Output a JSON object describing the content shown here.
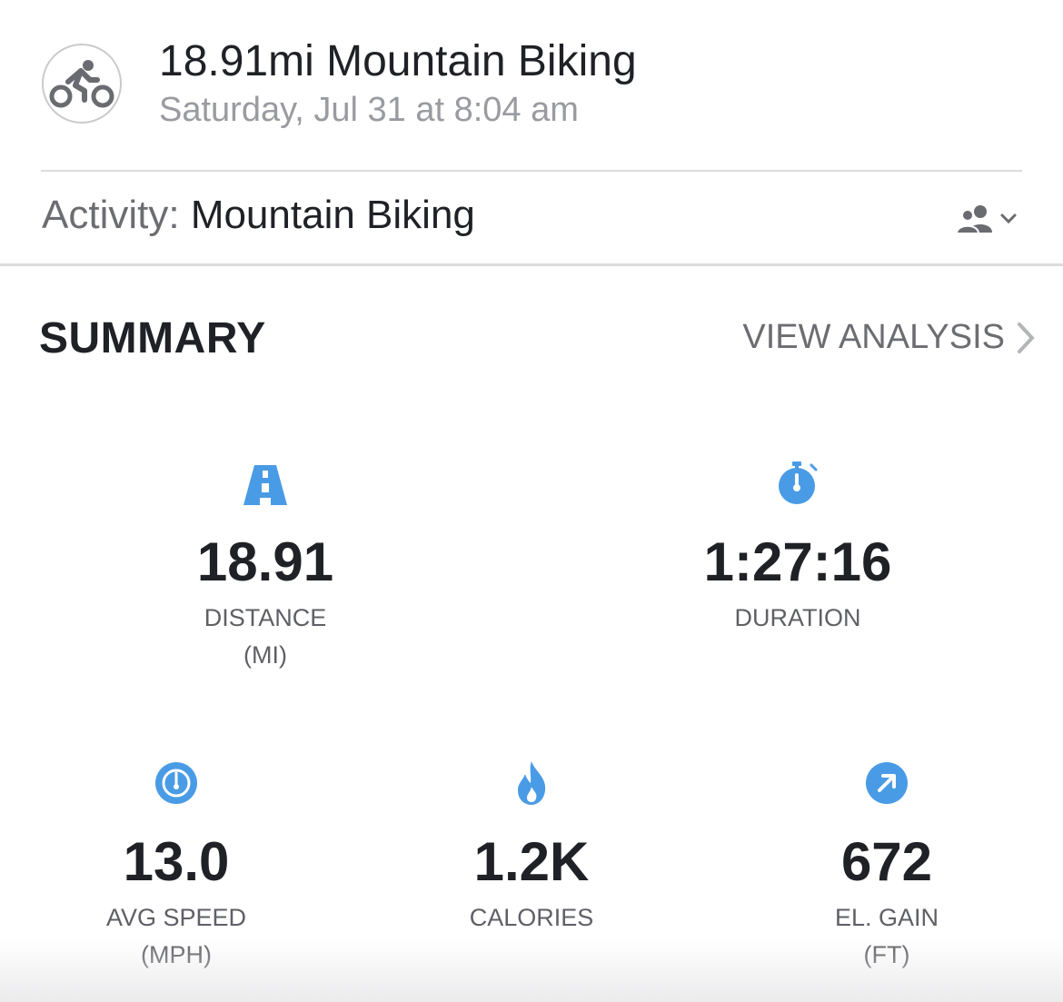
{
  "header": {
    "sport_icon": "bicycle-icon",
    "title": "18.91mi Mountain Biking",
    "subtitle": "Saturday, Jul 31 at 8:04 am"
  },
  "activity": {
    "label": "Activity:",
    "value": "Mountain Biking",
    "privacy_icon": "friends-icon"
  },
  "summary": {
    "title": "SUMMARY",
    "view_analysis": "VIEW ANALYSIS"
  },
  "stats": {
    "distance": {
      "icon": "road-icon",
      "value": "18.91",
      "label": "DISTANCE",
      "unit": "(MI)"
    },
    "duration": {
      "icon": "stopwatch-icon",
      "value": "1:27:16",
      "label": "DURATION"
    },
    "avg_speed": {
      "icon": "speedometer-icon",
      "value": "13.0",
      "label": "AVG SPEED",
      "unit": "(MPH)"
    },
    "calories": {
      "icon": "flame-icon",
      "value": "1.2K",
      "label": "CALORIES"
    },
    "elevation": {
      "icon": "arrow-up-right-icon",
      "value": "672",
      "label": "EL. GAIN",
      "unit": "(FT)"
    }
  },
  "colors": {
    "accent": "#4a9be6",
    "text": "#1f2126",
    "muted": "#9a9ba1"
  }
}
